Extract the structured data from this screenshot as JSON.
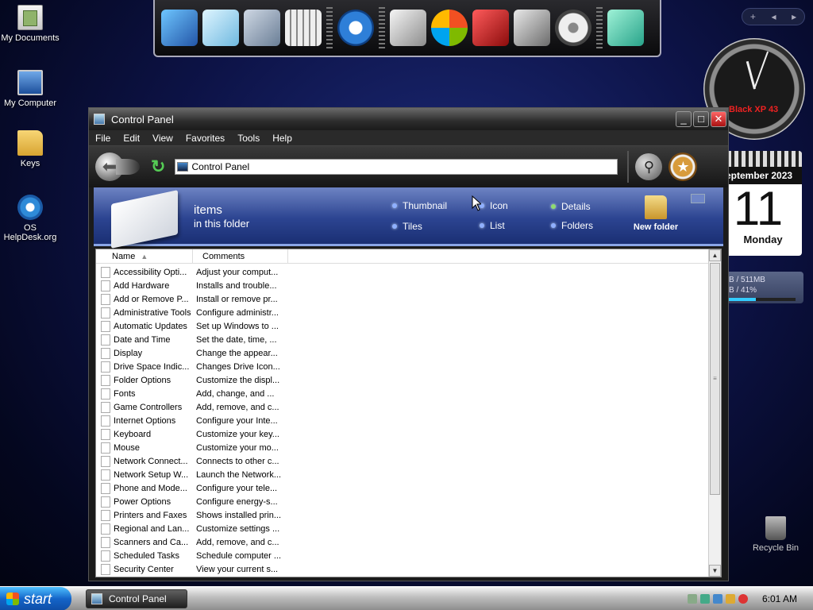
{
  "desktop": {
    "icons": [
      {
        "label": "My Documents"
      },
      {
        "label": "My Computer"
      },
      {
        "label": "Keys"
      },
      {
        "label": "OS HelpDesk.org"
      }
    ],
    "recycle_bin": "Recycle Bin"
  },
  "widgets": {
    "clock_brand": "Black XP 43",
    "calendar_month": "eptember 2023",
    "calendar_day": "11",
    "calendar_weekday": "Monday",
    "memory_line1": "B / 511MB",
    "memory_line2": "B / 41%",
    "memory_fraction": 0.41
  },
  "window": {
    "title": "Control Panel",
    "menu": [
      "File",
      "Edit",
      "View",
      "Favorites",
      "Tools",
      "Help"
    ],
    "address_value": "Control Panel",
    "banner_title": "items",
    "banner_subtitle": "in this folder",
    "view_options": [
      "Thumbnail",
      "Tiles",
      "Icon",
      "List",
      "Details",
      "Folders"
    ],
    "new_folder": "New folder",
    "columns": [
      "Name",
      "Comments"
    ],
    "items": [
      {
        "name": "Accessibility Opti...",
        "comment": "Adjust your comput..."
      },
      {
        "name": "Add Hardware",
        "comment": "Installs and trouble..."
      },
      {
        "name": "Add or Remove P...",
        "comment": "Install or remove pr..."
      },
      {
        "name": "Administrative Tools",
        "comment": "Configure administr..."
      },
      {
        "name": "Automatic Updates",
        "comment": "Set up Windows to ..."
      },
      {
        "name": "Date and Time",
        "comment": "Set the date, time, ..."
      },
      {
        "name": "Display",
        "comment": "Change the appear..."
      },
      {
        "name": "Drive Space Indic...",
        "comment": "Changes Drive Icon..."
      },
      {
        "name": "Folder Options",
        "comment": "Customize the displ..."
      },
      {
        "name": "Fonts",
        "comment": "Add, change, and ..."
      },
      {
        "name": "Game Controllers",
        "comment": "Add, remove, and c..."
      },
      {
        "name": "Internet Options",
        "comment": "Configure your Inte..."
      },
      {
        "name": "Keyboard",
        "comment": "Customize your key..."
      },
      {
        "name": "Mouse",
        "comment": "Customize your mo..."
      },
      {
        "name": "Network Connect...",
        "comment": "Connects to other c..."
      },
      {
        "name": "Network Setup W...",
        "comment": "Launch the Network..."
      },
      {
        "name": "Phone and Mode...",
        "comment": "Configure your tele..."
      },
      {
        "name": "Power Options",
        "comment": "Configure energy-s..."
      },
      {
        "name": "Printers and Faxes",
        "comment": "Shows installed prin..."
      },
      {
        "name": "Regional and Lan...",
        "comment": "Customize settings ..."
      },
      {
        "name": "Scanners and Ca...",
        "comment": "Add, remove, and c..."
      },
      {
        "name": "Scheduled Tasks",
        "comment": "Schedule computer ..."
      },
      {
        "name": "Security Center",
        "comment": "View your current s..."
      }
    ]
  },
  "taskbar": {
    "start_label": "start",
    "task_button": "Control Panel",
    "time": "6:01 AM"
  }
}
